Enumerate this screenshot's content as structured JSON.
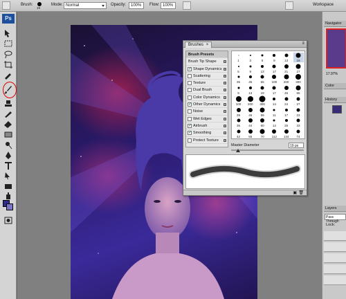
{
  "options_bar": {
    "brush_label": "Brush:",
    "brush_size": "19",
    "mode_label": "Mode:",
    "mode_value": "Normal",
    "opacity_label": "Opacity:",
    "opacity_value": "100%",
    "flow_label": "Flow:",
    "flow_value": "100%",
    "workspace_label": "Workspace"
  },
  "toolbox": {
    "logo": "Ps"
  },
  "brushes_panel": {
    "tab_label": "Brushes",
    "options": [
      {
        "label": "Brush Presets",
        "type": "header"
      },
      {
        "label": "Brush Tip Shape",
        "type": "plain"
      },
      {
        "label": "Shape Dynamics",
        "checked": true
      },
      {
        "label": "Scattering",
        "checked": false
      },
      {
        "label": "Texture",
        "checked": false
      },
      {
        "label": "Dual Brush",
        "checked": false
      },
      {
        "label": "Color Dynamics",
        "checked": false
      },
      {
        "label": "Other Dynamics",
        "checked": true
      },
      {
        "label": "Noise",
        "checked": false
      },
      {
        "label": "Wet Edges",
        "checked": false
      },
      {
        "label": "Airbrush",
        "checked": true
      },
      {
        "label": "Smoothing",
        "checked": true
      },
      {
        "label": "Protect Texture",
        "checked": false
      }
    ],
    "presets": [
      {
        "size": "1",
        "d": 1
      },
      {
        "size": "3",
        "d": 2
      },
      {
        "size": "5",
        "d": 3
      },
      {
        "size": "9",
        "d": 4
      },
      {
        "size": "13",
        "d": 5
      },
      {
        "size": "19",
        "d": 7
      },
      {
        "size": "5",
        "d": 2
      },
      {
        "size": "9",
        "d": 3
      },
      {
        "size": "13",
        "d": 4
      },
      {
        "size": "17",
        "d": 5
      },
      {
        "size": "21",
        "d": 6
      },
      {
        "size": "27",
        "d": 7
      },
      {
        "size": "35",
        "d": 3
      },
      {
        "size": "45",
        "d": 4
      },
      {
        "size": "65",
        "d": 5
      },
      {
        "size": "100",
        "d": 6
      },
      {
        "size": "200",
        "d": 7
      },
      {
        "size": "300",
        "d": 8
      },
      {
        "size": "9",
        "d": 3
      },
      {
        "size": "13",
        "d": 4
      },
      {
        "size": "19",
        "d": 5
      },
      {
        "size": "17",
        "d": 5
      },
      {
        "size": "45",
        "d": 6
      },
      {
        "size": "65",
        "d": 7
      },
      {
        "size": "100",
        "d": 8
      },
      {
        "size": "200",
        "d": 8
      },
      {
        "size": "300",
        "d": 9
      },
      {
        "size": "14",
        "d": 4
      },
      {
        "size": "24",
        "d": 5
      },
      {
        "size": "27",
        "d": 5
      },
      {
        "size": "39",
        "d": 6
      },
      {
        "size": "46",
        "d": 6
      },
      {
        "size": "59",
        "d": 7
      },
      {
        "size": "11",
        "d": 3
      },
      {
        "size": "17",
        "d": 4
      },
      {
        "size": "23",
        "d": 5
      },
      {
        "size": "36",
        "d": 5
      },
      {
        "size": "44",
        "d": 6
      },
      {
        "size": "60",
        "d": 6
      },
      {
        "size": "14",
        "d": 3
      },
      {
        "size": "26",
        "d": 4
      },
      {
        "size": "33",
        "d": 5
      },
      {
        "size": "42",
        "d": 5
      },
      {
        "size": "55",
        "d": 6
      },
      {
        "size": "70",
        "d": 7
      },
      {
        "size": "112",
        "d": 6
      },
      {
        "size": "134",
        "d": 6
      },
      {
        "size": "74",
        "d": 5
      }
    ],
    "master_diameter_label": "Master Diameter",
    "master_diameter_value": "19 px"
  },
  "right_panels": {
    "navigator_label": "Navigator",
    "zoom_value": "17.97%",
    "color_label": "Color",
    "history_label": "History",
    "layers_label": "Layers",
    "blend_value": "Pass Through",
    "lock_label": "Lock:"
  }
}
